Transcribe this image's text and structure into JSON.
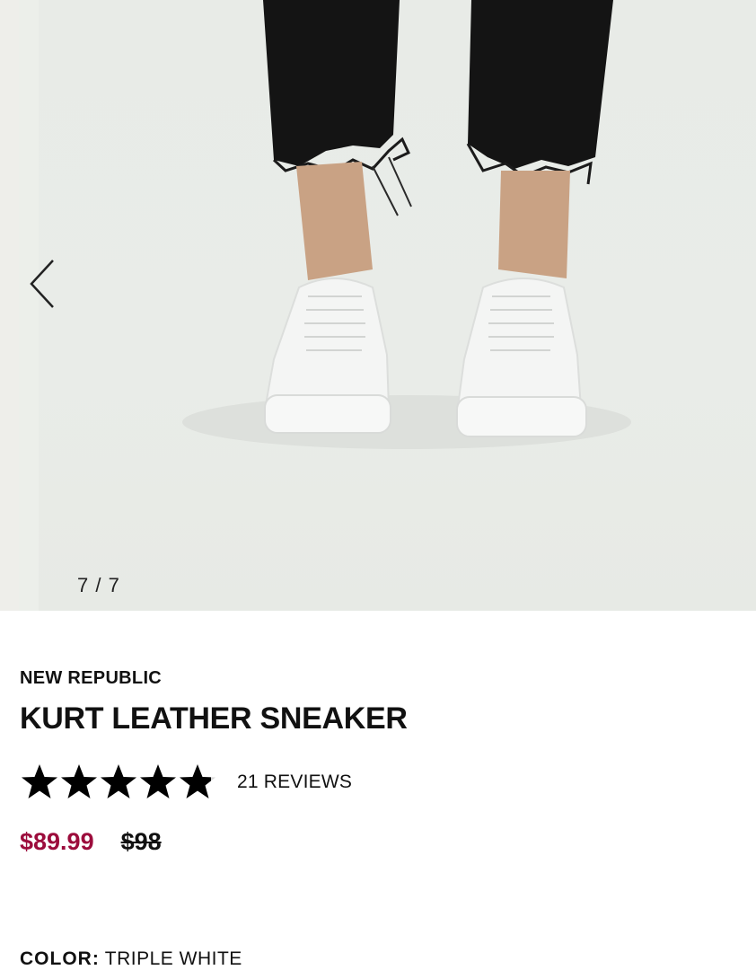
{
  "gallery": {
    "counter": "7 / 7",
    "prev_icon": "chevron-left-icon",
    "image": "white-leather-sneakers-photo"
  },
  "product": {
    "brand": "NEW REPUBLIC",
    "title": "KURT LEATHER SNEAKER",
    "rating": 4.8,
    "rating_max": 5,
    "reviews_label": "21 REVIEWS",
    "sale_price": "$89.99",
    "original_price": "$98",
    "color_label": "COLOR:",
    "color_value": "TRIPLE WHITE"
  },
  "colors": {
    "sale": "#9c0c3c",
    "text": "#111111",
    "gallery_bg": "#e9ece8"
  }
}
